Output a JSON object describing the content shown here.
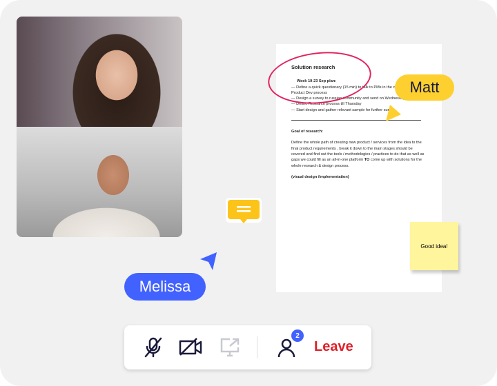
{
  "video_participants": [
    {
      "name": "participant-1"
    },
    {
      "name": "participant-2"
    }
  ],
  "document": {
    "title": "Solution research",
    "week_heading": "Week 19-23 Sep plan:",
    "tasks": [
      "— Define a quick questionary (15 min) to talk to PMs in the critical path in Product Dev process",
      "— Design a survey to russian community and send on Wednesday Thursday",
      "— Define Research process till Thursday",
      "— Start design and gather relevant sample for further survey"
    ],
    "goal_heading": "Goal of research:",
    "goal_before": "Define the whole path of creating new product / services from the idea to the final product requirements , break it down to the main stages should be covered and find out the tools / methodologies / practices to do that as well as gaps we could fill as an all-in-one platform ",
    "goal_bold": "TO",
    "goal_after": " come up with solutions for the whole research & design process.",
    "footer": "(visual design /implementation)"
  },
  "cursors": {
    "matt": "Matt",
    "melissa": "Melissa",
    "matt_color": "#fdd030",
    "melissa_color": "#4262ff"
  },
  "sticky_note": "Good idea!",
  "toolbar": {
    "participant_count": "2",
    "leave_label": "Leave",
    "leave_color": "#e0202a",
    "icons": [
      "mic-off-icon",
      "camera-off-icon",
      "screen-share-icon",
      "participants-icon"
    ]
  }
}
